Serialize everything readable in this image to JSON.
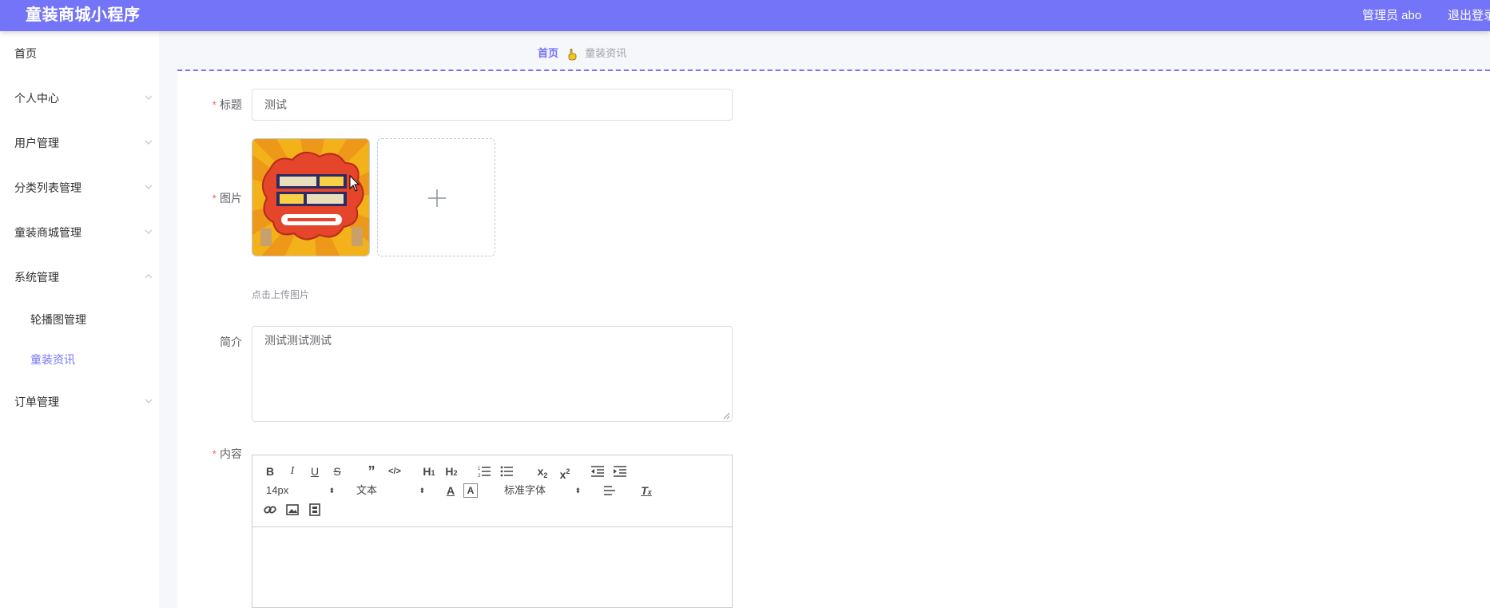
{
  "header": {
    "app_title": "童装商城小程序",
    "user_label": "管理员 abo",
    "logout_label": "退出登录"
  },
  "sidebar": {
    "items": [
      {
        "label": "首页"
      },
      {
        "label": "个人中心"
      },
      {
        "label": "用户管理"
      },
      {
        "label": "分类列表管理"
      },
      {
        "label": "童装商城管理"
      },
      {
        "label": "系统管理"
      },
      {
        "label": "订单管理"
      }
    ],
    "sub_items": [
      {
        "label": "轮播图管理"
      },
      {
        "label": "童装资讯"
      }
    ]
  },
  "breadcrumb": {
    "home": "首页",
    "current": "童装资讯"
  },
  "form": {
    "title_label": "标题",
    "title_value": "测试",
    "image_label": "图片",
    "upload_hint": "点击上传图片",
    "intro_label": "简介",
    "intro_value": "测试测试测试",
    "content_label": "内容",
    "required_mark": "*"
  },
  "editor": {
    "font_size": "14px",
    "header_select": "文本",
    "font_family": "标准字体"
  },
  "colors": {
    "accent": "#7474f8",
    "required": "#f56c6c"
  }
}
